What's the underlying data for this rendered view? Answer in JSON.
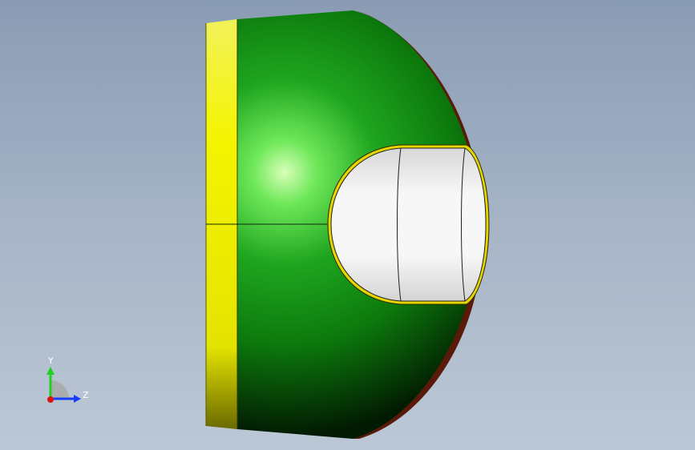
{
  "viewport": {
    "background_top": "#8a9cb4",
    "background_bottom": "#bcc8d6"
  },
  "model": {
    "flange_color": "#e8e800",
    "shell_color": "#1a9a1a",
    "shell_highlight": "#9dff8a",
    "cap_color": "#f2f2f2",
    "cap_rim_color": "#e8d800",
    "edge_color": "#6a1a0a"
  },
  "triad": {
    "y_label": "Y",
    "z_label": "Z",
    "y_color": "#1fd11f",
    "z_color": "#1a3cff",
    "x_color": "#e01010"
  }
}
